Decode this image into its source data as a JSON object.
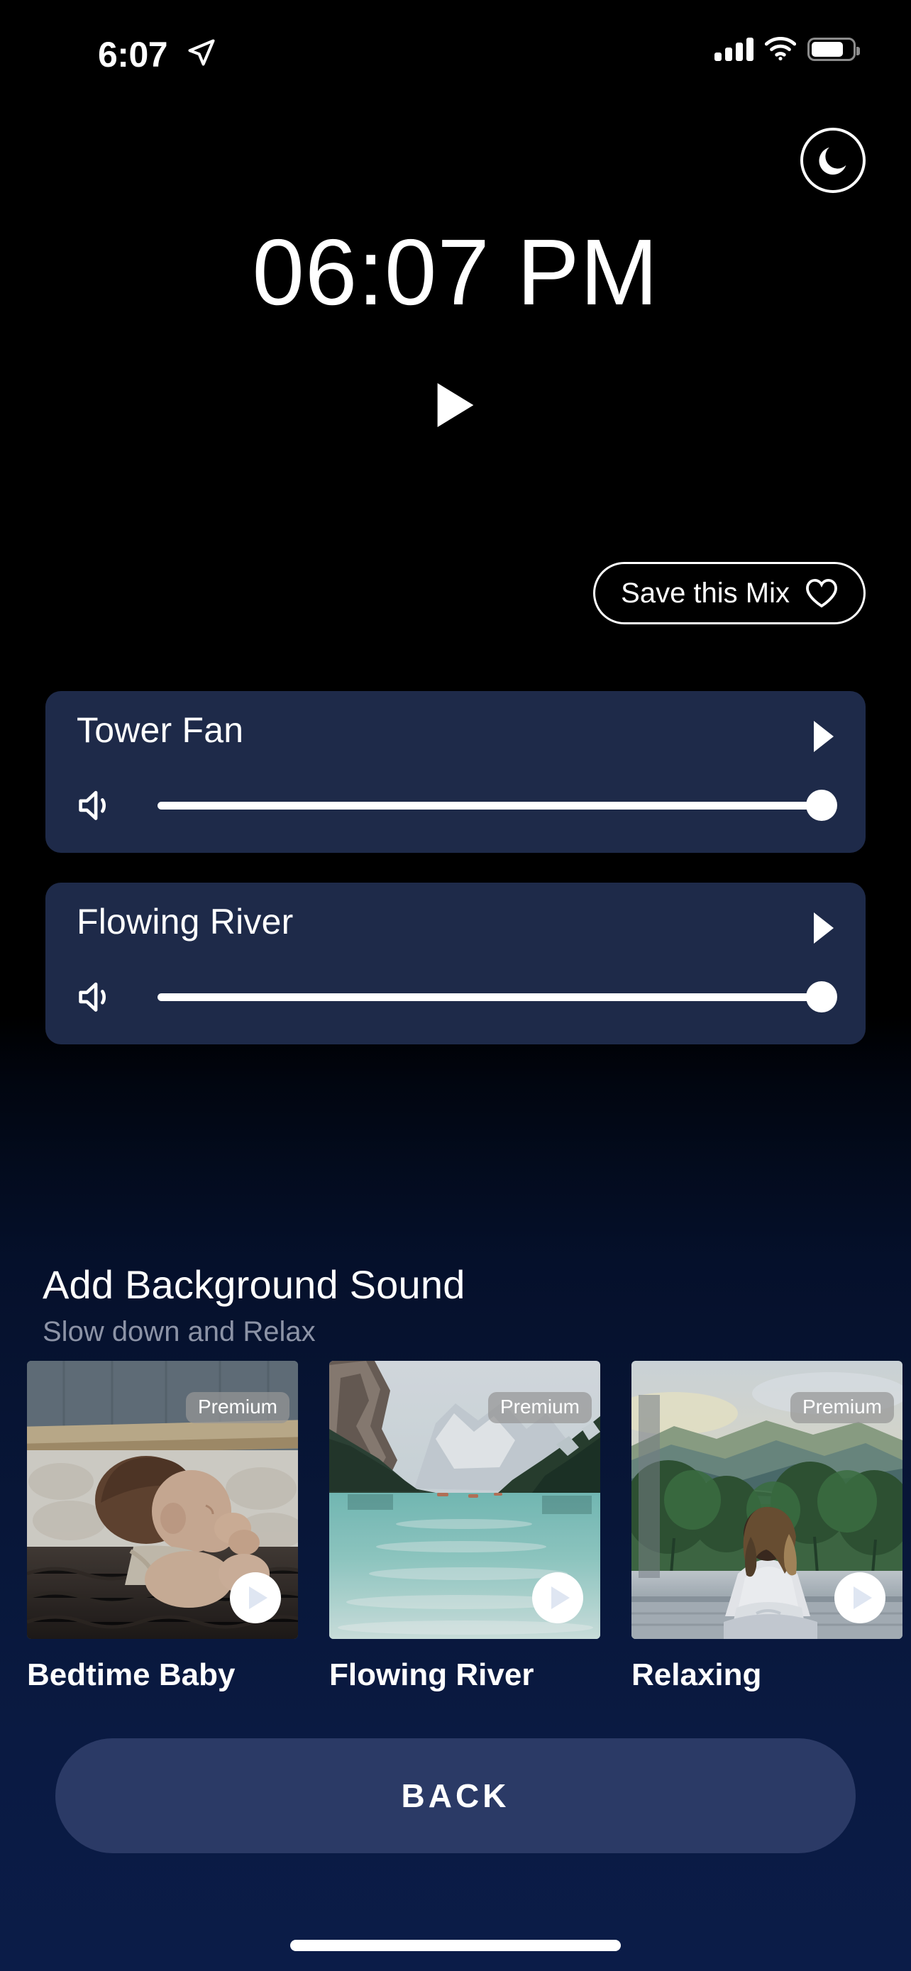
{
  "status_bar": {
    "time": "6:07",
    "location_icon": "location-arrow-icon",
    "signal_icon": "cellular-signal-icon",
    "wifi_icon": "wifi-icon",
    "battery_icon": "battery-icon",
    "battery_level_percent": 78
  },
  "header": {
    "night_mode_icon": "moon-icon"
  },
  "clock": {
    "hours_minutes": "06",
    "separator": ":",
    "minutes": "07",
    "meridiem": "PM",
    "full": "06:07 PM",
    "play_icon": "play-icon"
  },
  "save_mix": {
    "label": "Save this Mix",
    "icon": "heart-outline-icon"
  },
  "mix_sounds": [
    {
      "title": "Tower Fan",
      "play_icon": "play-icon",
      "volume_icon": "speaker-icon",
      "volume": 100
    },
    {
      "title": "Flowing River",
      "play_icon": "play-icon",
      "volume_icon": "speaker-icon",
      "volume": 100
    }
  ],
  "section": {
    "title": "Add Background Sound",
    "subtitle": "Slow down and Relax"
  },
  "sound_cards": [
    {
      "label": "Bedtime Baby",
      "badge": "Premium",
      "play_icon": "play-circle-icon",
      "image": "sleeping-baby-photo"
    },
    {
      "label": "Flowing River",
      "badge": "Premium",
      "play_icon": "play-circle-icon",
      "image": "turquoise-lake-mountains-photo"
    },
    {
      "label": "Relaxing",
      "badge": "Premium",
      "play_icon": "play-circle-icon",
      "image": "woman-robe-hills-photo"
    }
  ],
  "footer": {
    "back_label": "BACK"
  },
  "colors": {
    "background_top": "#000000",
    "background_bottom": "#0b1c48",
    "card": "#1e2a49",
    "back_button": "#2b3a66",
    "accent_text": "#ffffff",
    "muted_text": "#8c93a6"
  }
}
